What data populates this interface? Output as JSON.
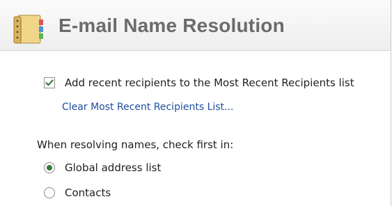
{
  "header": {
    "title": "E-mail Name Resolution",
    "icon": "address-book-icon"
  },
  "recent_recipients": {
    "checkbox_label": "Add recent recipients to the Most Recent Recipients list",
    "checked": true,
    "clear_link": "Clear Most Recent Recipients List..."
  },
  "resolution": {
    "prompt": "When resolving names, check first in:",
    "options": [
      {
        "label": "Global address list",
        "selected": true
      },
      {
        "label": "Contacts",
        "selected": false
      }
    ]
  },
  "colors": {
    "accent": "#3a7a3a",
    "link": "#1f4d9e",
    "title": "#6b6b6b"
  }
}
